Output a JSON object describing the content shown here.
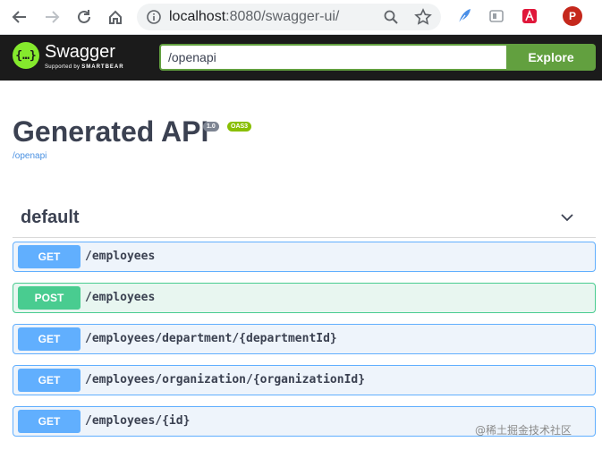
{
  "browser": {
    "url_host": "localhost",
    "url_rest": ":8080/swagger-ui/",
    "profile_initial": "P"
  },
  "topbar": {
    "brand_name": "Swagger",
    "brand_sub_prefix": "Supported by",
    "brand_sub_name": "SMARTBEAR",
    "brand_glyph": "{…}",
    "spec_url_value": "/openapi",
    "explore_label": "Explore"
  },
  "info": {
    "title": "Generated API",
    "version": "1.0",
    "oas_badge": "OAS3",
    "spec_link": "/openapi"
  },
  "tag": {
    "name": "default"
  },
  "operations": [
    {
      "method": "GET",
      "path": "/employees"
    },
    {
      "method": "POST",
      "path": "/employees"
    },
    {
      "method": "GET",
      "path": "/employees/department/{departmentId}"
    },
    {
      "method": "GET",
      "path": "/employees/organization/{organizationId}"
    },
    {
      "method": "GET",
      "path": "/employees/{id}"
    }
  ],
  "watermark": "@稀土掘金技术社区",
  "colors": {
    "get": "#61affe",
    "post": "#49cc90",
    "accent": "#62a03f",
    "topbar_bg": "#1b1b1b"
  }
}
